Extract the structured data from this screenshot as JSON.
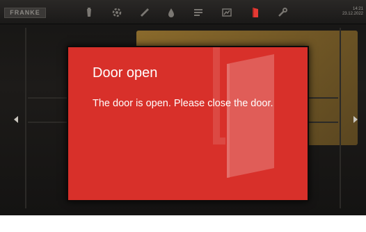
{
  "header": {
    "brand": "FRANKE",
    "clock_time": "14:21",
    "clock_date": "23.12.2022",
    "tabs": [
      {
        "name": "tab-drink-icon",
        "icon": "cup-icon"
      },
      {
        "name": "tab-settings-icon",
        "icon": "gear-icon"
      },
      {
        "name": "tab-cleaning-icon",
        "icon": "brush-icon"
      },
      {
        "name": "tab-water-icon",
        "icon": "drop-icon"
      },
      {
        "name": "tab-recipes-icon",
        "icon": "list-icon"
      },
      {
        "name": "tab-statistics-icon",
        "icon": "chart-icon"
      },
      {
        "name": "tab-door-icon",
        "icon": "door-icon",
        "active": true
      },
      {
        "name": "tab-service-icon",
        "icon": "wrench-icon"
      }
    ]
  },
  "dialog": {
    "title": "Door open",
    "message": "The door is open. Please close the door.",
    "background_color": "#d8302a"
  },
  "colors": {
    "screen_background": "#1a1918",
    "accent_red": "#e53a34"
  }
}
